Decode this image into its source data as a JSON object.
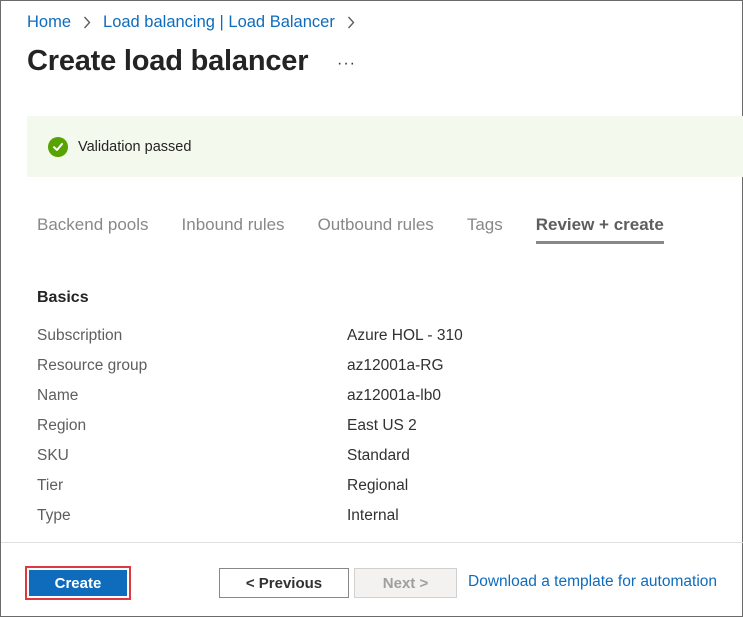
{
  "breadcrumb": {
    "items": [
      "Home",
      "Load balancing | Load Balancer"
    ]
  },
  "page": {
    "title": "Create load balancer",
    "more_label": "···"
  },
  "validation": {
    "text": "Validation passed",
    "status_color": "#57a300"
  },
  "tabs": [
    {
      "label": "Backend pools"
    },
    {
      "label": "Inbound rules"
    },
    {
      "label": "Outbound rules"
    },
    {
      "label": "Tags"
    },
    {
      "label": "Review + create",
      "active": true
    }
  ],
  "basics": {
    "title": "Basics",
    "rows": [
      {
        "label": "Subscription",
        "value": "Azure HOL - 310"
      },
      {
        "label": "Resource group",
        "value": "az12001a-RG"
      },
      {
        "label": "Name",
        "value": "az12001a-lb0"
      },
      {
        "label": "Region",
        "value": "East US 2"
      },
      {
        "label": "SKU",
        "value": "Standard"
      },
      {
        "label": "Tier",
        "value": "Regional"
      },
      {
        "label": "Type",
        "value": "Internal"
      }
    ]
  },
  "footer": {
    "create_label": "Create",
    "previous_label": "< Previous",
    "next_label": "Next >",
    "download_label": "Download a template for automation",
    "accent_color": "#0f6cbd",
    "highlight_color": "#e0383e"
  }
}
